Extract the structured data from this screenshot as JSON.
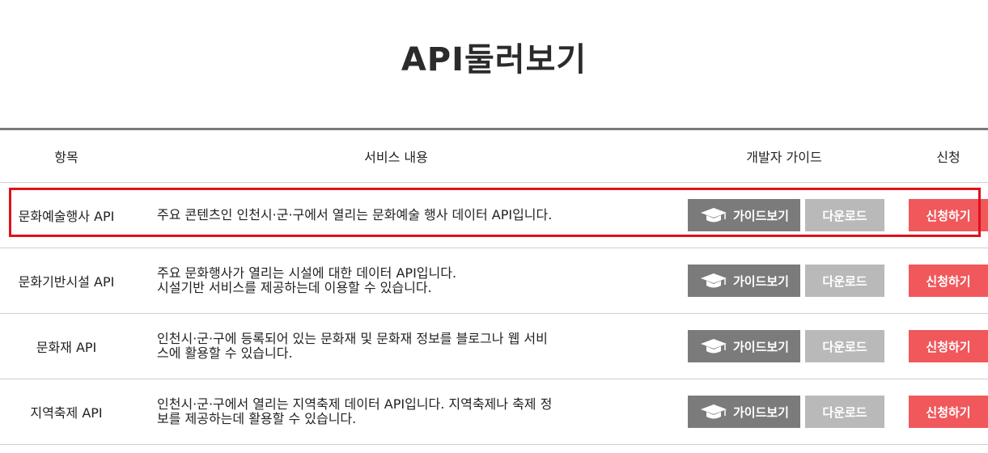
{
  "page": {
    "title": "API둘러보기"
  },
  "table": {
    "headers": {
      "item": "항목",
      "desc": "서비스 내용",
      "guide": "개발자 가이드",
      "apply": "신청"
    },
    "rows": [
      {
        "name": "문화예술행사 API",
        "desc_line1": "주요 콘텐츠인 인천시·군·구에서 열리는 문화예술 행사 데이터 API입니다.",
        "desc_line2": "",
        "guide_label": "가이드보기",
        "download_label": "다운로드",
        "apply_label": "신청하기",
        "highlighted": true
      },
      {
        "name": "문화기반시설 API",
        "desc_line1": "주요 문화행사가 열리는 시설에 대한 데이터 API입니다.",
        "desc_line2": "시설기반 서비스를 제공하는데 이용할 수 있습니다.",
        "guide_label": "가이드보기",
        "download_label": "다운로드",
        "apply_label": "신청하기",
        "highlighted": false
      },
      {
        "name": "문화재 API",
        "desc_line1": "인천시·군·구에 등록되어 있는 문화재 및 문화재 정보를 블로그나 웹 서비",
        "desc_line2": "스에 활용할 수 있습니다.",
        "guide_label": "가이드보기",
        "download_label": "다운로드",
        "apply_label": "신청하기",
        "highlighted": false
      },
      {
        "name": "지역축제 API",
        "desc_line1": "인천시·군·구에서 열리는 지역축제 데이터 API입니다. 지역축제나 축제 정",
        "desc_line2": "보를 제공하는데 활용할 수 있습니다.",
        "guide_label": "가이드보기",
        "download_label": "다운로드",
        "apply_label": "신청하기",
        "highlighted": false
      }
    ]
  },
  "icons": {
    "guide": "graduation-cap-icon"
  },
  "colors": {
    "guide_button": "#7b7b7b",
    "download_button": "#b9b9b9",
    "apply_button": "#f0585b",
    "highlight_border": "#e0111b"
  }
}
